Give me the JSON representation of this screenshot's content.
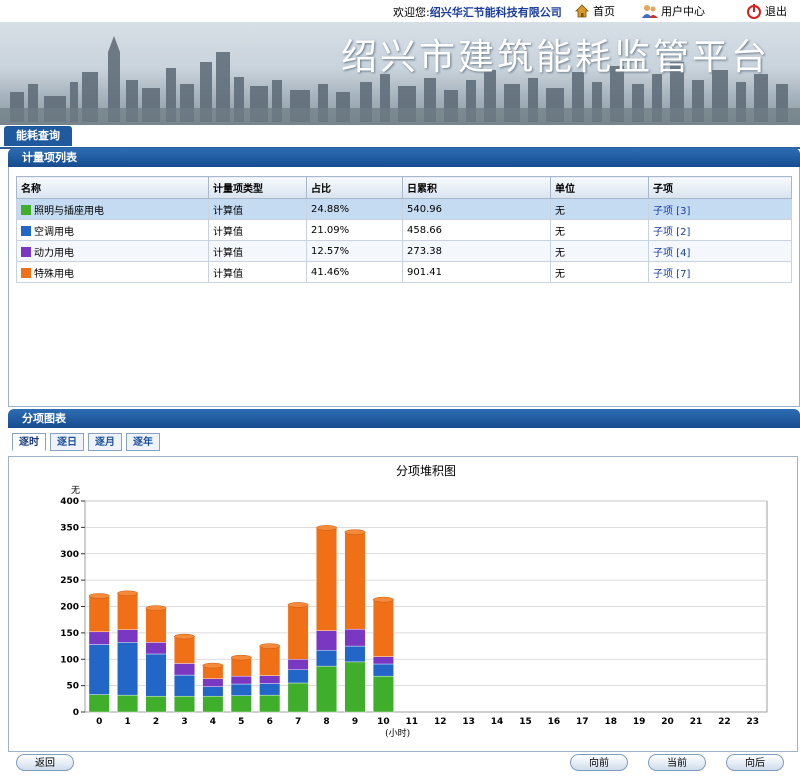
{
  "header": {
    "welcome_prefix": "欢迎您:",
    "company": "绍兴华汇节能科技有限公司",
    "links": {
      "home": "首页",
      "user_center": "用户中心",
      "logout": "退出"
    }
  },
  "banner": {
    "title": "绍兴市建筑能耗监管平台"
  },
  "nav": {
    "active_tab": "能耗查询"
  },
  "metering_section": {
    "title": "计量项列表",
    "columns": [
      "名称",
      "计量项类型",
      "占比",
      "日累积",
      "单位",
      "子项"
    ],
    "rows": [
      {
        "name": "照明与插座用电",
        "type": "计算值",
        "ratio": "24.88%",
        "daily": "540.96",
        "unit": "无",
        "sub": "子项 [3]",
        "color": "#3fae2a"
      },
      {
        "name": "空调用电",
        "type": "计算值",
        "ratio": "21.09%",
        "daily": "458.66",
        "unit": "无",
        "sub": "子项 [2]",
        "color": "#2266c8"
      },
      {
        "name": "动力用电",
        "type": "计算值",
        "ratio": "12.57%",
        "daily": "273.38",
        "unit": "无",
        "sub": "子项 [4]",
        "color": "#7a38c2"
      },
      {
        "name": "特殊用电",
        "type": "计算值",
        "ratio": "41.46%",
        "daily": "901.41",
        "unit": "无",
        "sub": "子项 [7]",
        "color": "#f07018"
      }
    ]
  },
  "chart_section": {
    "title": "分项图表",
    "tabs": [
      "逐时",
      "逐日",
      "逐月",
      "逐年"
    ],
    "active_tab": "逐时"
  },
  "chart_data": {
    "type": "bar",
    "stacked": true,
    "title": "分项堆积图",
    "ylabel": "无",
    "xlabel": "(小时)",
    "ylim": [
      0,
      400
    ],
    "yticks": [
      0,
      50,
      100,
      150,
      200,
      250,
      300,
      350,
      400
    ],
    "categories": [
      "0",
      "1",
      "2",
      "3",
      "4",
      "5",
      "6",
      "7",
      "8",
      "9",
      "10",
      "11",
      "12",
      "13",
      "14",
      "15",
      "16",
      "17",
      "18",
      "19",
      "20",
      "21",
      "22",
      "23"
    ],
    "series": [
      {
        "name": "照明与插座用电",
        "color": "#3fae2a",
        "values": [
          33,
          32,
          30,
          30,
          30,
          31,
          32,
          55,
          87,
          95,
          68,
          0,
          0,
          0,
          0,
          0,
          0,
          0,
          0,
          0,
          0,
          0,
          0,
          0
        ]
      },
      {
        "name": "空调用电",
        "color": "#2266c8",
        "values": [
          95,
          100,
          80,
          40,
          18,
          22,
          22,
          25,
          30,
          30,
          23,
          0,
          0,
          0,
          0,
          0,
          0,
          0,
          0,
          0,
          0,
          0,
          0,
          0
        ]
      },
      {
        "name": "动力用电",
        "color": "#7a38c2",
        "values": [
          24,
          24,
          22,
          22,
          15,
          15,
          15,
          20,
          37,
          32,
          14,
          0,
          0,
          0,
          0,
          0,
          0,
          0,
          0,
          0,
          0,
          0,
          0,
          0
        ]
      },
      {
        "name": "特殊用电",
        "color": "#f07018",
        "values": [
          68,
          69,
          65,
          51,
          25,
          35,
          56,
          103,
          195,
          184,
          108,
          0,
          0,
          0,
          0,
          0,
          0,
          0,
          0,
          0,
          0,
          0,
          0,
          0
        ]
      }
    ],
    "grid": true,
    "legend": "none"
  },
  "footer": {
    "back": "返回",
    "prev": "向前",
    "current": "当前",
    "next": "向后"
  }
}
